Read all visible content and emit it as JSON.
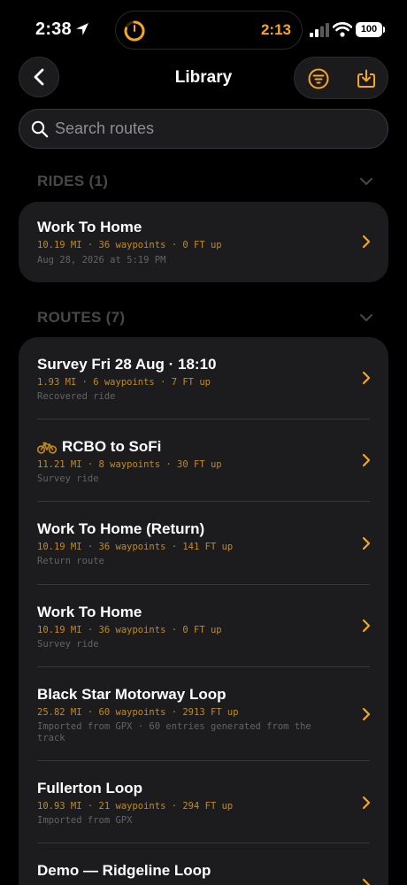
{
  "status": {
    "time": "2:38",
    "timer": "2:13",
    "battery": "100"
  },
  "header": {
    "title": "Library"
  },
  "search": {
    "placeholder": "Search routes"
  },
  "rides_section": {
    "title": "RIDES (1)"
  },
  "rides": [
    {
      "title": "Work To Home",
      "meta": "10.19 MI · 36 waypoints · 0 FT up",
      "sub": "Aug 28, 2026 at 5:19 PM"
    }
  ],
  "routes_section": {
    "title": "ROUTES (7)"
  },
  "routes": [
    {
      "title": "Survey Fri 28 Aug · 18:10",
      "meta": "1.93 MI · 6 waypoints · 7 FT up",
      "sub": "Recovered ride"
    },
    {
      "title": "RCBO to SoFi",
      "meta": "11.21 MI · 8 waypoints · 30 FT up",
      "sub": "Survey ride",
      "icon": "bicycle-icon"
    },
    {
      "title": "Work To Home (Return)",
      "meta": "10.19 MI · 36 waypoints · 141 FT up",
      "sub": "Return route"
    },
    {
      "title": "Work To Home",
      "meta": "10.19 MI · 36 waypoints · 0 FT up",
      "sub": "Survey ride"
    },
    {
      "title": "Black Star Motorway Loop",
      "meta": "25.82 MI · 60 waypoints · 2913 FT up",
      "sub": "Imported from GPX · 60 entries generated from the track"
    },
    {
      "title": "Fullerton Loop",
      "meta": "10.93 MI · 21 waypoints · 294 FT up",
      "sub": "Imported from GPX"
    },
    {
      "title": "Demo — Ridgeline Loop",
      "meta": "",
      "sub": ""
    }
  ],
  "colors": {
    "accent": "#f5a623",
    "meta": "#c28a1e",
    "card": "#1c1c1e",
    "background": "#000000"
  }
}
